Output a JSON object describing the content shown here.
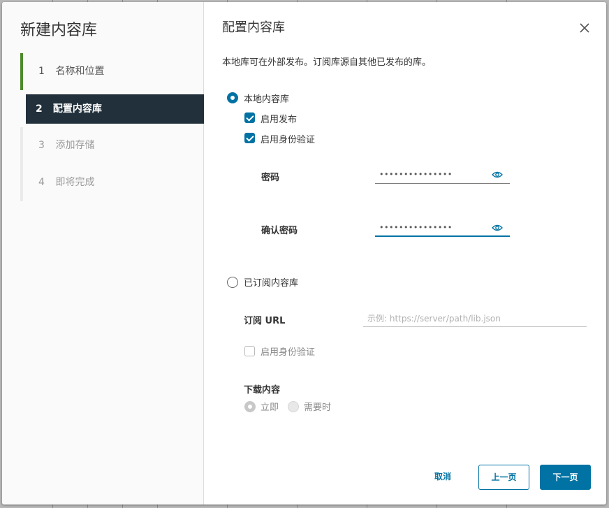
{
  "wizard": {
    "title": "新建内容库",
    "steps": [
      {
        "num": "1",
        "label": "名称和位置",
        "state": "done"
      },
      {
        "num": "2",
        "label": "配置内容库",
        "state": "active"
      },
      {
        "num": "3",
        "label": "添加存储",
        "state": "pending"
      },
      {
        "num": "4",
        "label": "即将完成",
        "state": "pending"
      }
    ]
  },
  "page": {
    "title": "配置内容库",
    "description": "本地库可在外部发布。订阅库源自其他已发布的库。",
    "close_icon": "close-icon"
  },
  "local_library": {
    "label": "本地内容库",
    "selected": true,
    "enable_publish_label": "启用发布",
    "enable_publish_checked": true,
    "enable_auth_label": "启用身份验证",
    "enable_auth_checked": true,
    "password_label": "密码",
    "password_value": "•••••••••••••••",
    "confirm_password_label": "确认密码",
    "confirm_password_value": "•••••••••••••••",
    "eye_icon": "eye-icon"
  },
  "subscribed_library": {
    "label": "已订阅内容库",
    "selected": false,
    "url_label": "订阅 URL",
    "url_placeholder": "示例: https://server/path/lib.json",
    "enable_auth_label": "启用身份验证",
    "enable_auth_checked": false,
    "download_label": "下载内容",
    "download_options": [
      {
        "label": "立即",
        "selected": true
      },
      {
        "label": "需要时",
        "selected": false
      }
    ]
  },
  "footer": {
    "cancel_label": "取消",
    "prev_label": "上一页",
    "next_label": "下一页"
  },
  "colors": {
    "accent": "#0072a3",
    "nav_active_bg": "#21303a",
    "step_done": "#4d8a2c"
  }
}
